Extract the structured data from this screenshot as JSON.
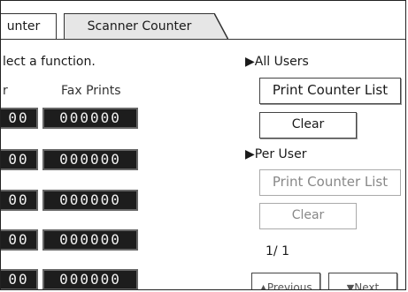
{
  "tabs": [
    {
      "label": "unter"
    },
    {
      "label": "Scanner Counter"
    }
  ],
  "prompt": "lect a function.",
  "columns": {
    "partial_header": "r",
    "fax_prints_header": "Fax Prints"
  },
  "rows": [
    {
      "left": "00",
      "fax": "000000"
    },
    {
      "left": "00",
      "fax": "000000"
    },
    {
      "left": "00",
      "fax": "000000"
    },
    {
      "left": "00",
      "fax": "000000"
    },
    {
      "left": "00",
      "fax": "000000"
    }
  ],
  "all_users": {
    "heading": "All Users",
    "print_counter_list": "Print Counter List",
    "clear": "Clear"
  },
  "per_user": {
    "heading": "Per User",
    "print_counter_list": "Print Counter List",
    "clear": "Clear"
  },
  "pagination": {
    "page_indicator": "1/  1",
    "previous": "Previous",
    "next": "Next"
  }
}
